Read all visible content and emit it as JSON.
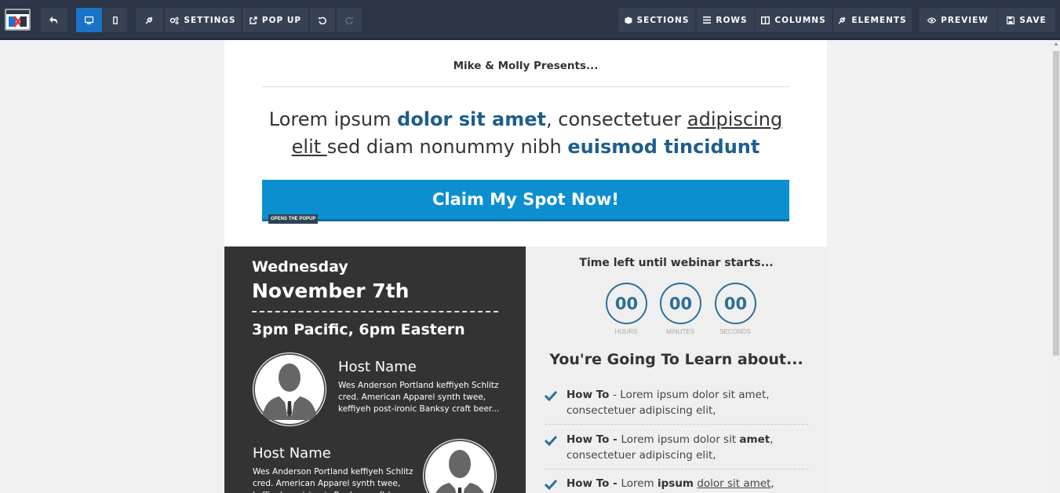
{
  "toolbar": {
    "settings": "SETTINGS",
    "popup": "POP UP",
    "sections": "SECTIONS",
    "rows": "ROWS",
    "columns": "COLUMNS",
    "elements": "ELEMENTS",
    "preview": "PREVIEW",
    "save": "SAVE"
  },
  "page": {
    "presents": "Mike & Molly Presents...",
    "headline": {
      "p1": "Lorem ipsum ",
      "b1": "dolor sit amet",
      "p2": ", consectetuer ",
      "u1": "adipiscing elit ",
      "p3": "sed diam nonummy nibh ",
      "b2": "euismod tincidunt"
    },
    "cta": "Claim My Spot Now!",
    "cta_tag": "OPENS THE POPUP"
  },
  "event": {
    "day": "Wednesday",
    "date": "November 7th",
    "time": "3pm Pacific, 6pm Eastern",
    "hosts": [
      {
        "name": "Host Name",
        "bio": "Wes Anderson Portland keffiyeh Schlitz cred. American Apparel synth twee, keffiyeh post-ironic Banksy craft beer..."
      },
      {
        "name": "Host Name",
        "bio": "Wes Anderson Portland keffiyeh Schlitz cred. American Apparel synth twee, keffiyeh post-ironic Banksy craft beer..."
      }
    ]
  },
  "countdown": {
    "title": "Time left until webinar starts...",
    "hours": "00",
    "minutes": "00",
    "seconds": "00",
    "hours_label": "HOURS",
    "minutes_label": "MINUTES",
    "seconds_label": "SECONDS"
  },
  "learn": {
    "title": "You're Going To  Learn about...",
    "items": [
      {
        "b": "How To ",
        "t": " - Lorem ipsum dolor sit amet, consectetuer adipiscing elit,"
      },
      {
        "b": "How To - ",
        "t1": "Lorem ipsum dolor sit ",
        "b2": "amet",
        "t2": ", consectetuer adipiscing elit,"
      },
      {
        "b": "How To - ",
        "t1": "Lorem ",
        "b2": "ipsum",
        "t2": " ",
        "u": "dolor sit amet",
        "t3": ","
      }
    ]
  },
  "colors": {
    "toolbar": "#2c3646",
    "accent": "#1a73c8",
    "cta": "#0c8fd0",
    "heading_blue": "#1d5e8c",
    "dark_panel": "#333333"
  }
}
